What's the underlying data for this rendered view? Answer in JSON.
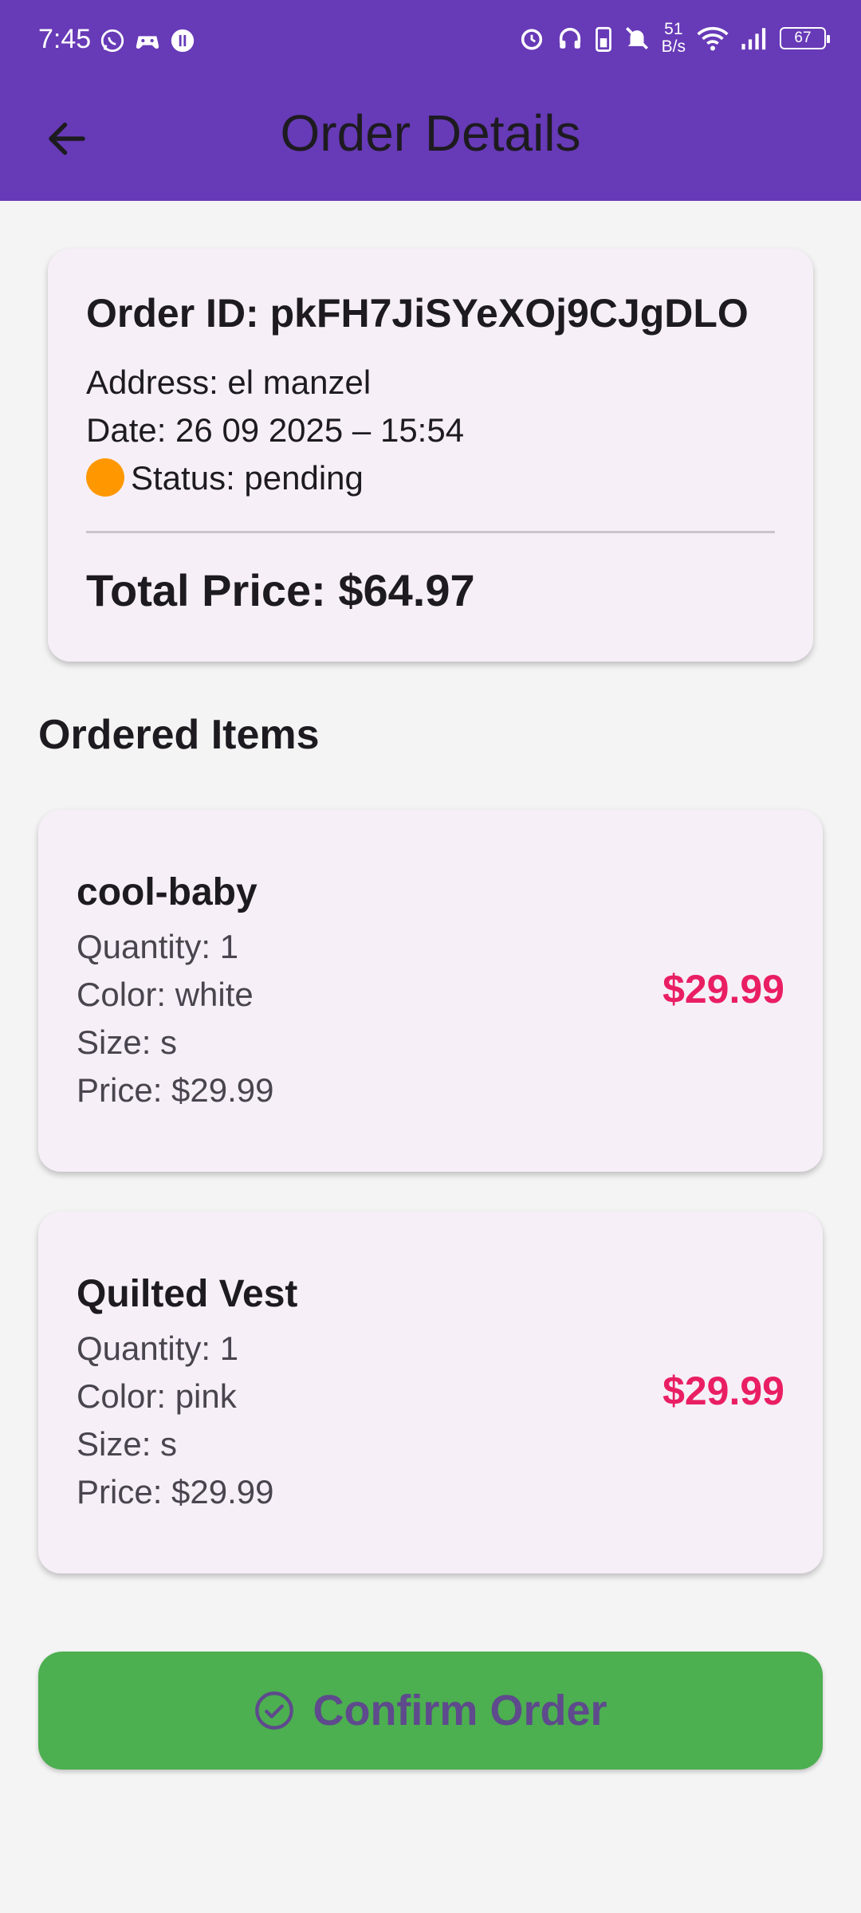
{
  "status_bar": {
    "time": "7:45",
    "net_speed_value": "51",
    "net_speed_unit": "B/s",
    "battery": "67",
    "icons_left": [
      "whatsapp-icon",
      "game-controller-icon",
      "app-icon"
    ],
    "icons_right": [
      "alarm-icon",
      "headphones-icon",
      "battery-saver-icon",
      "bell-off-icon",
      "wifi-icon",
      "signal-icon",
      "battery-icon"
    ]
  },
  "app_bar": {
    "title": "Order Details",
    "back_icon": "arrow-back-icon",
    "background": "#673ab7"
  },
  "order": {
    "id_text": "Order ID: pkFH7JiSYeXOj9CJgDLO",
    "address_text": "Address: el manzel",
    "date_text": "Date: 26 09 2025 – 15:54",
    "status_text": "Status: pending",
    "status_color": "#ff9800",
    "total_text": "Total Price: $64.97"
  },
  "items_section": {
    "title": "Ordered Items",
    "items": [
      {
        "name": "cool-baby",
        "quantity": "Quantity: 1",
        "color": "Color: white",
        "size": "Size: s",
        "price_line": "Price: $29.99",
        "price": "$29.99"
      },
      {
        "name": "Quilted Vest",
        "quantity": "Quantity: 1",
        "color": "Color: pink",
        "size": "Size: s",
        "price_line": "Price: $29.99",
        "price": "$29.99"
      }
    ],
    "price_color": "#e91e63"
  },
  "confirm_button": {
    "label": "Confirm Order",
    "icon": "check-circle-icon",
    "background": "#4caf50"
  }
}
